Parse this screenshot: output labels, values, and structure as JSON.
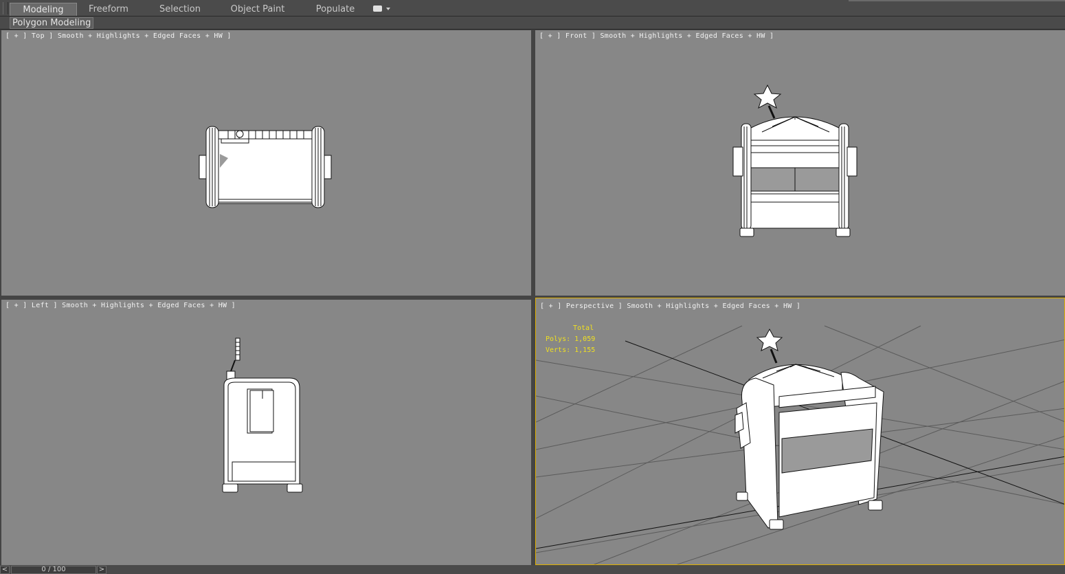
{
  "ribbon": {
    "tabs": [
      {
        "label": "Modeling",
        "active": true
      },
      {
        "label": "Freeform",
        "active": false
      },
      {
        "label": "Selection",
        "active": false
      },
      {
        "label": "Object Paint",
        "active": false
      },
      {
        "label": "Populate",
        "active": false
      }
    ],
    "subpanel_label": "Polygon Modeling"
  },
  "viewports": {
    "top": {
      "label": "[ + ] Top ] Smooth + Highlights + Edged Faces + HW ]"
    },
    "front": {
      "label": "[ + ] Front ] Smooth + Highlights + Edged Faces + HW ]"
    },
    "left": {
      "label": "[ + ] Left ] Smooth + Highlights + Edged Faces + HW ]"
    },
    "perspective": {
      "label": "[ + ] Perspective ] Smooth + Highlights + Edged Faces + HW ]"
    }
  },
  "stats": {
    "title": "Total",
    "polys": "Polys: 1,059",
    "verts": "Verts: 1,155"
  },
  "timeline": {
    "counter": "0 / 100",
    "prev": "<",
    "next": ">"
  },
  "colors": {
    "viewport_bg": "#878787",
    "active_border": "#e0b000",
    "stats_text": "#f0e020"
  }
}
